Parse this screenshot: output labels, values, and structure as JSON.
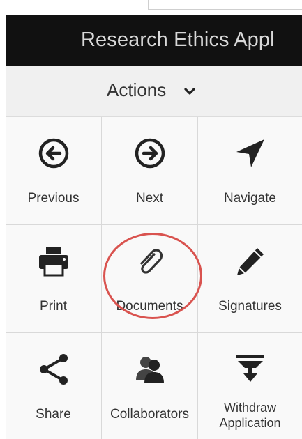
{
  "header": {
    "title": "Research Ethics Appl"
  },
  "actions": {
    "label": "Actions",
    "chevron_icon": "chevron-down-icon"
  },
  "tiles": [
    {
      "label": "Previous",
      "icon": "arrow-circle-left-icon"
    },
    {
      "label": "Next",
      "icon": "arrow-circle-right-icon"
    },
    {
      "label": "Navigate",
      "icon": "location-arrow-icon"
    },
    {
      "label": "Print",
      "icon": "print-icon"
    },
    {
      "label": "Documents",
      "icon": "paperclip-icon"
    },
    {
      "label": "Signatures",
      "icon": "pencil-icon"
    },
    {
      "label": "Share",
      "icon": "share-icon"
    },
    {
      "label": "Collaborators",
      "icon": "users-icon"
    },
    {
      "label_line1": "Withdraw",
      "label_line2": "Application",
      "icon": "withdraw-icon"
    }
  ],
  "colors": {
    "title_bar_bg": "#111111",
    "title_text": "#d8d8d8",
    "tile_bg": "#f9f9f9",
    "icon_color": "#222222",
    "highlight_ring": "#d9534f"
  }
}
